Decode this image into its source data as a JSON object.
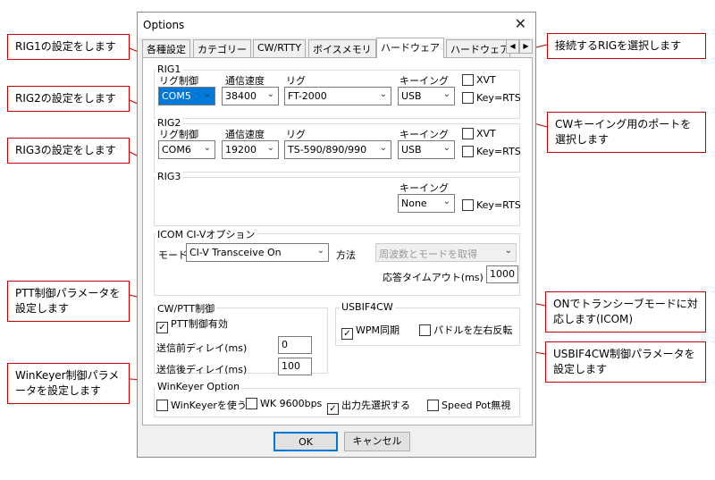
{
  "dialog": {
    "title": "Options",
    "ok_label": "OK",
    "cancel_label": "キャンセル"
  },
  "tabs": [
    "各種設定",
    "カテゴリー",
    "CW/RTTY",
    "ボイスメモリ",
    "ハードウェア",
    "ハードウェア"
  ],
  "active_tab": "ハードウェア",
  "headers": {
    "rig_control": "リグ制御",
    "baud": "通信速度",
    "rig": "リグ",
    "keying": "キーイング"
  },
  "rig1": {
    "label": "RIG1",
    "port": "COM5",
    "baud": "38400",
    "rig": "FT-2000",
    "keying": "USB",
    "xvt": "XVT",
    "keyrts": "Key=RTS"
  },
  "rig2": {
    "label": "RIG2",
    "port": "COM6",
    "baud": "19200",
    "rig": "TS-590/890/990",
    "keying": "USB",
    "xvt": "XVT",
    "keyrts": "Key=RTS"
  },
  "rig3": {
    "label": "RIG3",
    "keying": "None",
    "keyrts": "Key=RTS"
  },
  "icom": {
    "label": "ICOM CI-Vオプション",
    "mode_label": "モード",
    "mode": "CI-V Transceive On",
    "method_label": "方法",
    "method": "周波数とモードを取得",
    "timeout_label": "応答タイムアウト(ms)",
    "timeout": "1000"
  },
  "ptt": {
    "label": "CW/PTT制御",
    "enable": "PTT制御有効",
    "pre_delay_label": "送信前ディレイ(ms)",
    "pre_delay": "0",
    "post_delay_label": "送信後ディレイ(ms)",
    "post_delay": "100"
  },
  "usbif": {
    "label": "USBIF4CW",
    "wpm_sync": "WPM同期",
    "paddle_swap": "パドルを左右反転"
  },
  "winkeyer": {
    "label": "WinKeyer Option",
    "use": "WinKeyerを使う",
    "wk9600": "WK 9600bps",
    "output": "出力先選択する",
    "speedpot": "Speed Pot無視"
  },
  "annotations": {
    "rig1": "RIG1の設定をします",
    "rig2": "RIG2の設定をします",
    "rig3": "RIG3の設定をします",
    "ptt": "PTT制御パラメータを設定します",
    "winkeyer": "WinKeyer制御パラメータを設定します",
    "connect": "接続するRIGを選択します",
    "cwkey": "CWキーイング用のポートを選択します",
    "icom": "ONでトランシーブモードに対応します(ICOM)",
    "usbif": "USBIF4CW制御パラメータを設定します"
  }
}
